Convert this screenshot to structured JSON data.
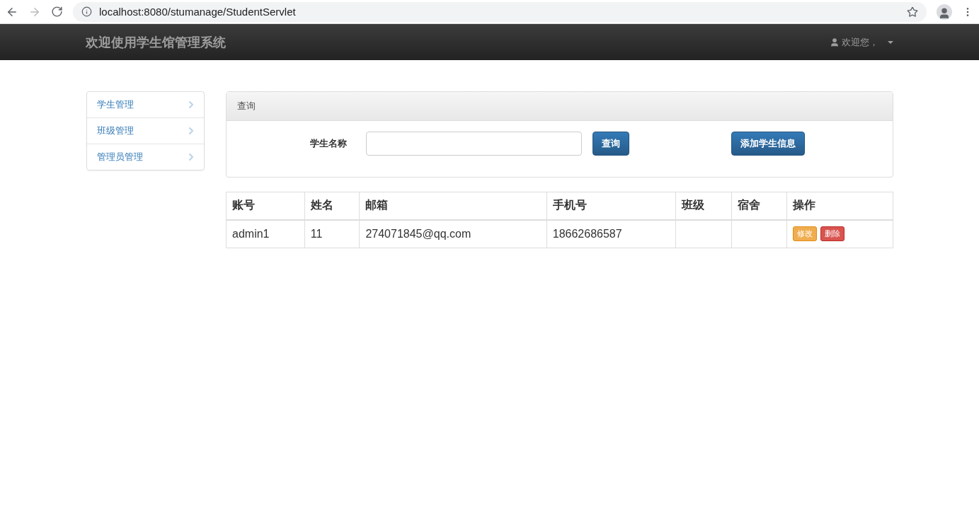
{
  "browser": {
    "url": "localhost:8080/stumanage/StudentServlet"
  },
  "navbar": {
    "brand": "欢迎使用学生馆管理系统",
    "user": "欢迎您，"
  },
  "sidebar": {
    "items": [
      {
        "label": "学生管理"
      },
      {
        "label": "班级管理"
      },
      {
        "label": "管理员管理"
      }
    ]
  },
  "search_panel": {
    "title": "查询",
    "field_label": "学生名称",
    "search_button": "查询",
    "add_button": "添加学生信息"
  },
  "table": {
    "columns": [
      "账号",
      "姓名",
      "邮箱",
      "手机号",
      "班级",
      "宿舍",
      "操作"
    ],
    "rows": [
      {
        "cells": [
          "admin1",
          "11",
          "274071845@qq.com",
          "18662686587",
          "",
          ""
        ],
        "actions": [
          {
            "label": "修改",
            "kind": "edit"
          },
          {
            "label": "删除",
            "kind": "delete"
          }
        ]
      }
    ]
  }
}
